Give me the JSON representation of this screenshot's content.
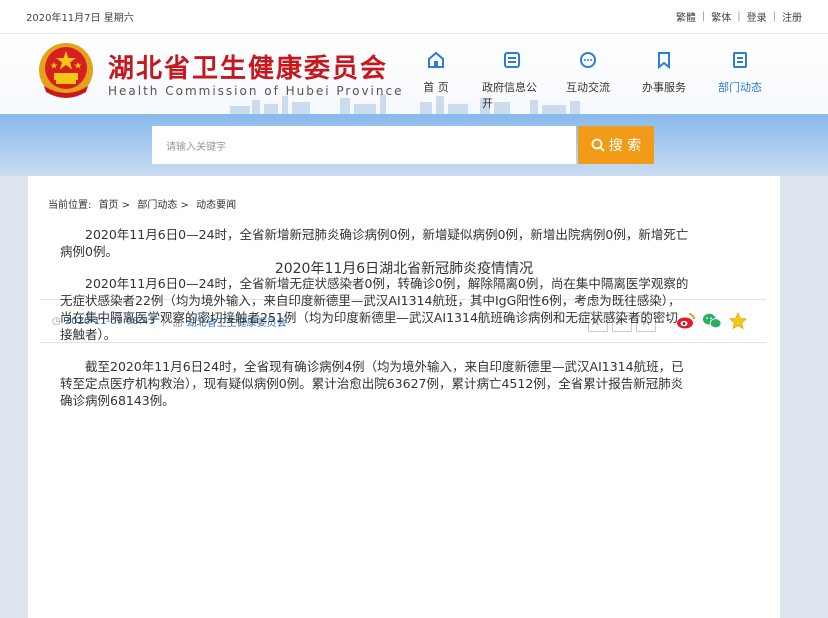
{
  "topbar": {
    "date": "2020年11月7日 星期六",
    "links": [
      "繁體",
      "繁体",
      "登录",
      "注册"
    ]
  },
  "header": {
    "title_cn": "湖北省卫生健康委员会",
    "title_en": "Health Commission of Hubei Province",
    "nav": [
      {
        "label": "首 页",
        "icon": "home-icon"
      },
      {
        "label": "政府信息公开",
        "icon": "document-list-icon"
      },
      {
        "label": "互动交流",
        "icon": "chat-bubble-icon"
      },
      {
        "label": "办事服务",
        "icon": "bookmark-icon"
      },
      {
        "label": "部门动态",
        "icon": "news-icon",
        "active": true
      }
    ]
  },
  "search": {
    "placeholder": "请输入关键字",
    "button_label": "搜 索"
  },
  "breadcrumb": {
    "prefix": "当前位置:",
    "items": [
      "首页",
      "部门动态",
      "动态要闻"
    ],
    "separator": ">"
  },
  "article": {
    "title": "2020年11月6日湖北省新冠肺炎疫情情况",
    "datetime": "2020-11-07 08:43",
    "source": "湖北省卫生健康委员会",
    "font_sizes": [
      "A⁺",
      "A⁻",
      "A"
    ],
    "paragraphs": [
      "2020年11月6日0—24时，全省新增新冠肺炎确诊病例0例，新增疑似病例0例，新增出院病例0例，新增死亡病例0例。",
      "2020年11月6日0—24时，全省新增无症状感染者0例，转确诊0例，解除隔离0例，尚在集中隔离医学观察的无症状感染者22例（均为境外输入，来自印度新德里—武汉AI1314航班，其中IgG阳性6例，考虑为既往感染），尚在集中隔离医学观察的密切接触者251例（均为印度新德里—武汉AI1314航班确诊病例和无症状感染者的密切接触者）。",
      "截至2020年11月6日24时，全省现有确诊病例4例（均为境外输入，来自印度新德里—武汉AI1314航班，已转至定点医疗机构救治），现有疑似病例0例。累计治愈出院63627例，累计病亡4512例，全省累计报告新冠肺炎确诊病例68143例。"
    ]
  },
  "colors": {
    "brand_red": "#c8161d",
    "accent_blue": "#2e7cd6",
    "search_orange": "#f29b18"
  }
}
